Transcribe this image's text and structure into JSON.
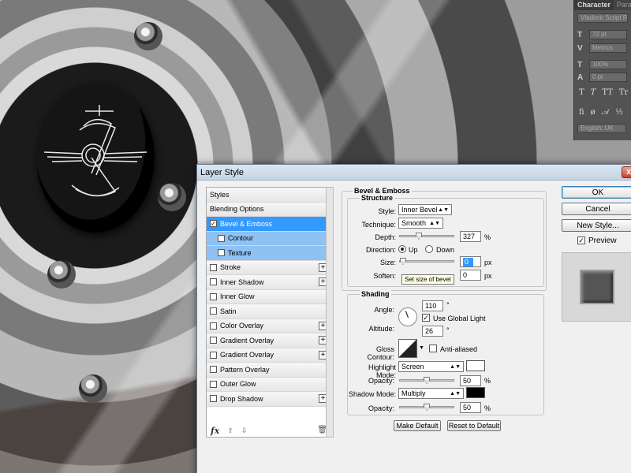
{
  "character_panel": {
    "tabs": [
      "Character",
      "Paragra"
    ],
    "font_family": "Vladimir Script Re...",
    "font_size": "72 pt",
    "kerning": "Metrics",
    "vertical_scale": "100%",
    "baseline_shift": "0 pt",
    "type_toggles": [
      "T",
      "T",
      "TT",
      "Tr"
    ],
    "language": "English: UK"
  },
  "dialog": {
    "title": "Layer Style",
    "close_glyph": "x",
    "styles_list": [
      {
        "label": "Styles",
        "type": "header"
      },
      {
        "label": "Blending Options",
        "type": "header"
      },
      {
        "label": "Bevel & Emboss",
        "checked": true,
        "selected": true,
        "has_plus": false
      },
      {
        "label": "Contour",
        "checked": false,
        "sub": true,
        "has_plus": false
      },
      {
        "label": "Texture",
        "checked": false,
        "sub": true,
        "has_plus": false
      },
      {
        "label": "Stroke",
        "checked": false,
        "has_plus": true
      },
      {
        "label": "Inner Shadow",
        "checked": false,
        "has_plus": true
      },
      {
        "label": "Inner Glow",
        "checked": false,
        "has_plus": false
      },
      {
        "label": "Satin",
        "checked": false,
        "has_plus": false
      },
      {
        "label": "Color Overlay",
        "checked": false,
        "has_plus": true
      },
      {
        "label": "Gradient Overlay",
        "checked": false,
        "has_plus": true
      },
      {
        "label": "Gradient Overlay",
        "checked": false,
        "has_plus": true
      },
      {
        "label": "Pattern Overlay",
        "checked": false,
        "has_plus": false
      },
      {
        "label": "Outer Glow",
        "checked": false,
        "has_plus": false
      },
      {
        "label": "Drop Shadow",
        "checked": false,
        "has_plus": true
      }
    ],
    "footer": {
      "fx": "fx",
      "up": "⇧",
      "down": "⇩",
      "trash": "🗑"
    },
    "bevel_emboss": {
      "title": "Bevel & Emboss",
      "structure_title": "Structure",
      "style_label": "Style:",
      "style_value": "Inner Bevel",
      "technique_label": "Technique:",
      "technique_value": "Smooth",
      "depth_label": "Depth:",
      "depth_value": "327",
      "depth_unit": "%",
      "depth_level": 0.33,
      "direction_label": "Direction:",
      "direction_up": "Up",
      "direction_down": "Down",
      "direction_selected": "Up",
      "size_label": "Size:",
      "size_value": "0",
      "size_unit": "px",
      "size_level": 0.0,
      "soften_label": "Soften:",
      "soften_value": "0",
      "soften_unit": "px",
      "tooltip": "Set size of bevel"
    },
    "shading": {
      "title": "Shading",
      "angle_label": "Angle:",
      "angle_value": "110",
      "angle_unit": "°",
      "global_light_label": "Use Global Light",
      "global_light_checked": true,
      "altitude_label": "Altitude:",
      "altitude_value": "26",
      "altitude_unit": "°",
      "gloss_contour_label": "Gloss Contour:",
      "anti_aliased_label": "Anti-aliased",
      "anti_aliased_checked": false,
      "highlight_mode_label": "Highlight Mode:",
      "highlight_mode_value": "Screen",
      "highlight_color": "#ffffff",
      "highlight_opacity_label": "Opacity:",
      "highlight_opacity_value": "50",
      "highlight_opacity_unit": "%",
      "highlight_opacity_level": 0.5,
      "shadow_mode_label": "Shadow Mode:",
      "shadow_mode_value": "Multiply",
      "shadow_color": "#000000",
      "shadow_opacity_label": "Opacity:",
      "shadow_opacity_value": "50",
      "shadow_opacity_unit": "%",
      "shadow_opacity_level": 0.5
    },
    "make_default": "Make Default",
    "reset_to_default": "Reset to Default",
    "ok": "OK",
    "cancel": "Cancel",
    "new_style": "New Style...",
    "preview_label": "Preview",
    "preview_checked": true
  },
  "colors": {
    "selected_blue": "#3399ff",
    "sub_item_blue": "#8fc1f2"
  }
}
